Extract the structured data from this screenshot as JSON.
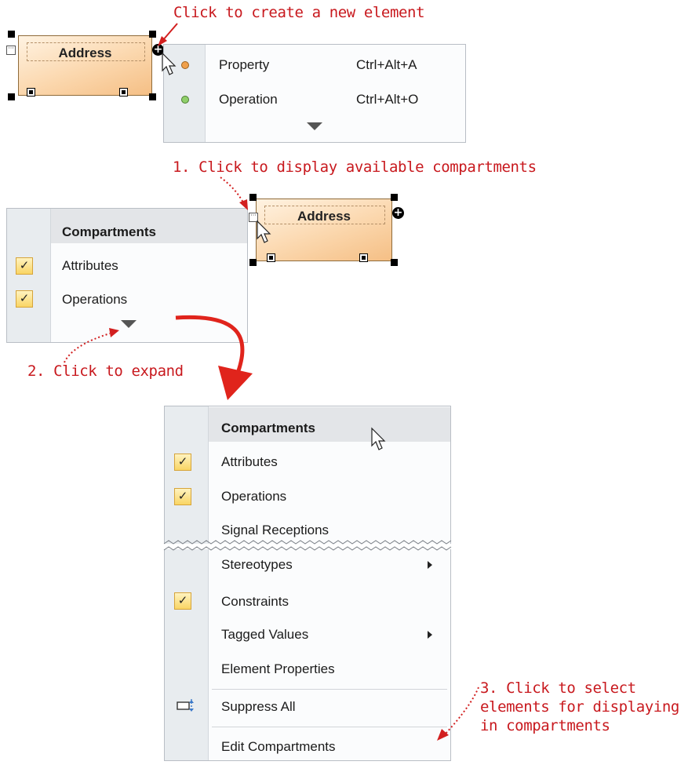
{
  "annotations": {
    "create": "Click to create a new element",
    "display": "1. Click to display available compartments",
    "expand": "2. Click to expand",
    "select": "3. Click to select\nelements for displaying\nin compartments"
  },
  "shapes": {
    "top_name": "Address",
    "mid_name": "Address"
  },
  "create_menu": {
    "items": [
      {
        "label": "Property",
        "shortcut": "Ctrl+Alt+A",
        "icon": "property-icon",
        "icon_color": "#f0a04b"
      },
      {
        "label": "Operation",
        "shortcut": "Ctrl+Alt+O",
        "icon": "operation-icon",
        "icon_color": "#8fcf6a"
      }
    ]
  },
  "compact_menu": {
    "header": "Compartments",
    "items": [
      {
        "label": "Attributes",
        "checked": true
      },
      {
        "label": "Operations",
        "checked": true
      }
    ]
  },
  "full_menu": {
    "header": "Compartments",
    "items": [
      {
        "label": "Attributes",
        "checked": true
      },
      {
        "label": "Operations",
        "checked": true
      },
      {
        "label": "Signal Receptions",
        "checked": false
      },
      {
        "label": "Stereotypes",
        "checked": false,
        "submenu": true
      },
      {
        "label": "Constraints",
        "checked": true
      },
      {
        "label": "Tagged Values",
        "checked": false,
        "submenu": true
      },
      {
        "label": "Element Properties",
        "checked": false
      },
      {
        "label": "Suppress All",
        "icon": "suppress-icon"
      },
      {
        "label": "Edit Compartments"
      }
    ]
  },
  "colors": {
    "annotation": "#c8191e",
    "check_fill": "#f9d564"
  }
}
